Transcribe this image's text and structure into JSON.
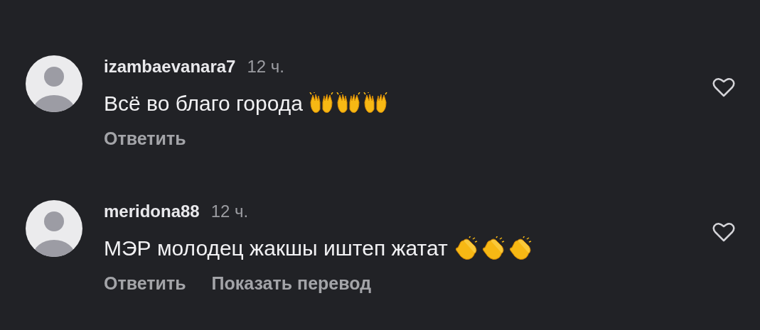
{
  "comments": [
    {
      "username": "izambaevanara7",
      "time": "12 ч.",
      "text": "Всё во благо города",
      "emojis": [
        {
          "kind": "raised_hands"
        },
        {
          "kind": "raised_hands"
        },
        {
          "kind": "raised_hands"
        }
      ],
      "liked": false,
      "actions": [
        "Ответить"
      ]
    },
    {
      "username": "meridona88",
      "time": "12 ч.",
      "text": "МЭР молодец жакшы иштеп жатат",
      "emojis": [
        {
          "kind": "clap"
        },
        {
          "kind": "clap"
        },
        {
          "kind": "clap"
        }
      ],
      "liked": false,
      "actions": [
        "Ответить",
        "Показать перевод"
      ]
    }
  ]
}
